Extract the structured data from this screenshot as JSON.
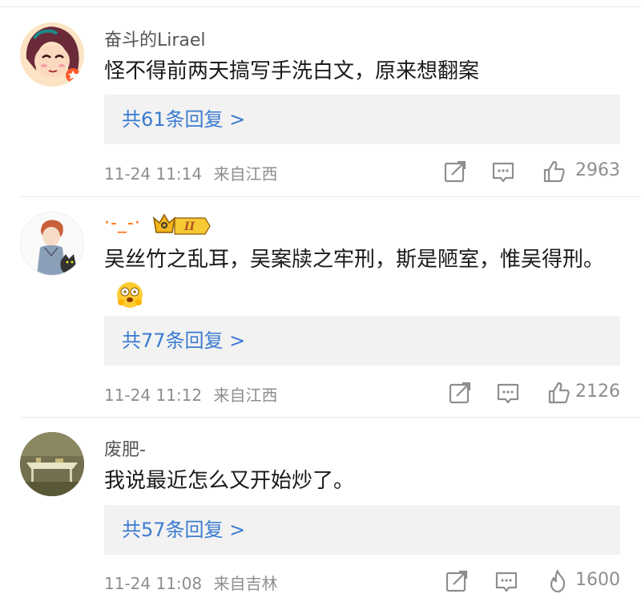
{
  "comments": [
    {
      "username": "奋斗的Lirael",
      "content": "怪不得前两天搞写手洗白文，原来想翻案",
      "reply_link": "共61条回复 >",
      "timestamp": "11-24 11:14",
      "location": "来自江西",
      "like_count": "2963",
      "avatar_icon": "cartoon-girl-avatar",
      "like_icon": "thumbs-up-icon"
    },
    {
      "username": "·-_-·",
      "badge": "II",
      "content": "吴丝竹之乱耳，吴案牍之牢刑，斯是陋室，惟吴得刑。",
      "reply_link": "共77条回复 >",
      "timestamp": "11-24 11:12",
      "location": "来自江西",
      "like_count": "2126",
      "avatar_icon": "anime-boy-with-cat-avatar",
      "like_icon": "thumbs-up-icon"
    },
    {
      "username": "废肥-",
      "content": "我说最近怎么又开始炒了。",
      "reply_link": "共57条回复 >",
      "timestamp": "11-24 11:08",
      "location": "来自吉林",
      "like_count": "1600",
      "avatar_icon": "table-photo-avatar",
      "like_icon": "flame-icon"
    }
  ],
  "colors": {
    "link_blue": "#3b7bd1",
    "username_orange": "#ff6a00",
    "meta_gray": "#8e8e8e",
    "reply_box_bg": "#f2f2f2"
  }
}
